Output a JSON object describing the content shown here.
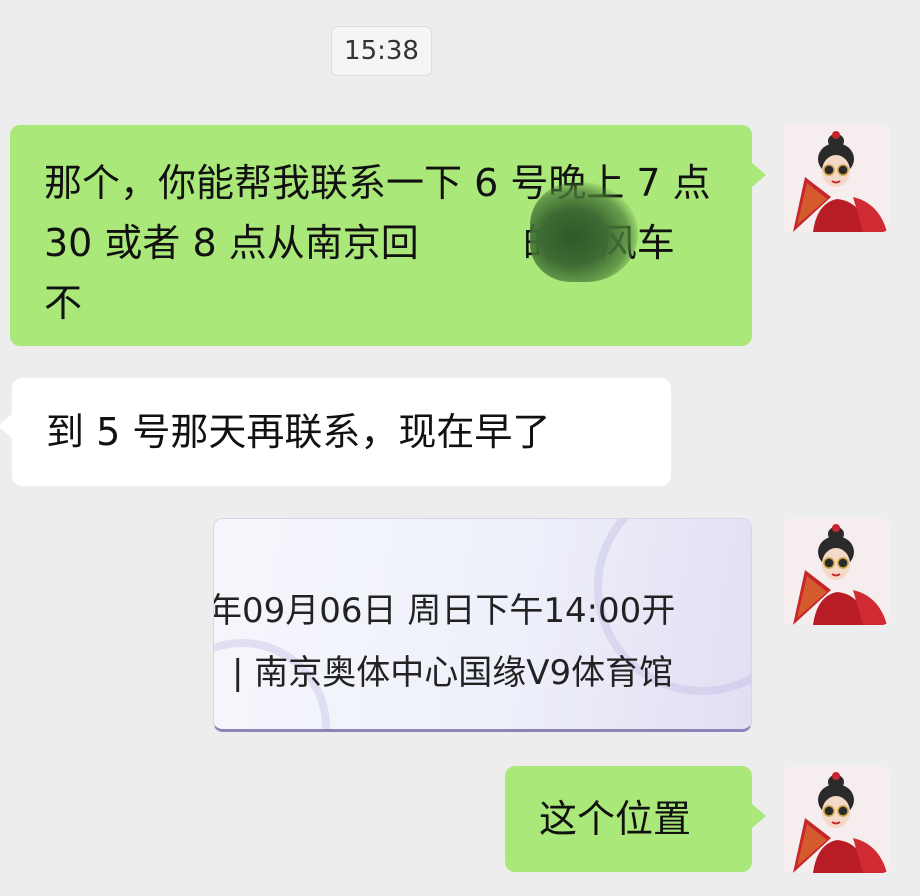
{
  "timestamp": "15:38",
  "messages": [
    {
      "side": "right",
      "text": "那个，你能帮我联系一下 6 号晚上 7 点 30 或者 8 点从南京回",
      "text_after_redaction": "的顺风车不"
    },
    {
      "side": "left",
      "text": "到 5 号那天再联系，现在早了"
    },
    {
      "side": "right",
      "type": "card",
      "line1": "年09月06日 周日下午14:00开",
      "line2": "| 南京奥体中心国缘V9体育馆"
    },
    {
      "side": "right",
      "text": "这个位置"
    }
  ],
  "colors": {
    "background": "#ededed",
    "bubble_self": "#a9e879",
    "bubble_other": "#ffffff"
  },
  "icons": {
    "avatar": "user-avatar-icon"
  }
}
